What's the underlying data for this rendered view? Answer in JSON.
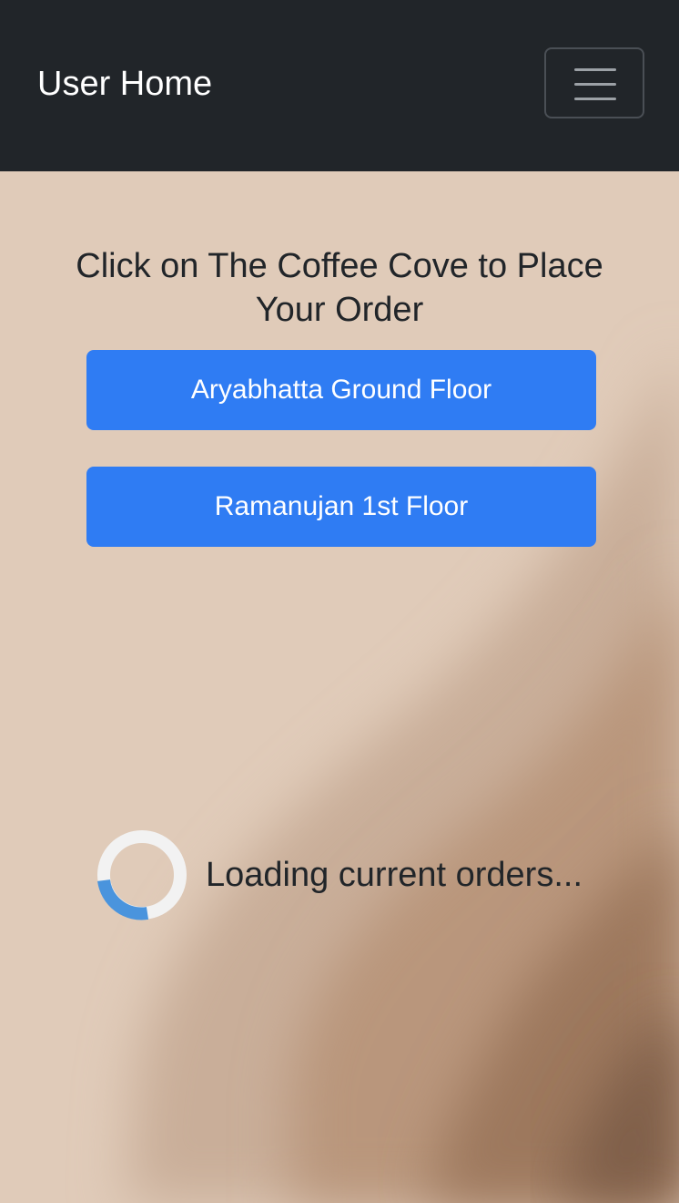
{
  "navbar": {
    "brand": "User Home",
    "toggler_icon": "hamburger-menu-icon"
  },
  "main": {
    "heading": "Click on The Coffee Cove to Place Your Order",
    "locations": [
      {
        "label": "Aryabhatta Ground Floor"
      },
      {
        "label": "Ramanujan 1st Floor"
      }
    ],
    "loading": {
      "text": "Loading current orders...",
      "icon": "spinner-icon"
    }
  },
  "colors": {
    "navbar_bg": "#212529",
    "page_bg": "#e0cbb9",
    "button_bg": "#2f7cf3",
    "spinner_track": "#f2f2f2",
    "spinner_arc": "#4a94dd"
  }
}
